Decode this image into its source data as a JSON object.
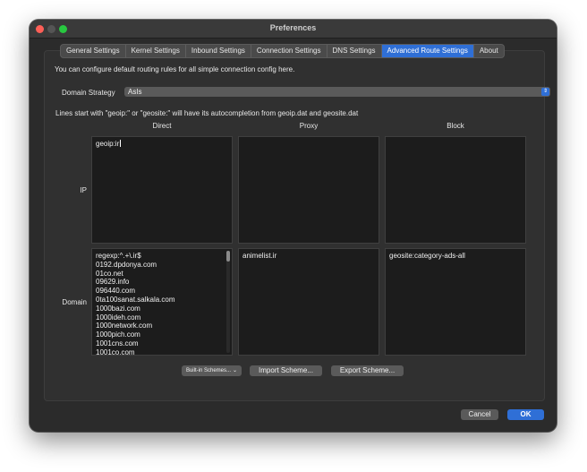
{
  "window": {
    "title": "Preferences"
  },
  "tabs": [
    {
      "label": "General Settings",
      "active": false
    },
    {
      "label": "Kernel Settings",
      "active": false
    },
    {
      "label": "Inbound Settings",
      "active": false
    },
    {
      "label": "Connection Settings",
      "active": false
    },
    {
      "label": "DNS Settings",
      "active": false
    },
    {
      "label": "Advanced Route Settings",
      "active": true
    },
    {
      "label": "About",
      "active": false
    }
  ],
  "routing": {
    "description": "You can configure default routing rules for all simple connection config here.",
    "domain_strategy_label": "Domain Strategy",
    "domain_strategy_value": "AsIs",
    "hint": "Lines start with \"geoip:\" or \"geosite:\" will have its autocompletion from geoip.dat and geosite.dat",
    "columns": {
      "direct": "Direct",
      "proxy": "Proxy",
      "block": "Block"
    },
    "rows": {
      "ip": "IP",
      "domain": "Domain"
    },
    "ip": {
      "direct": [
        "geoip:ir"
      ],
      "proxy": [],
      "block": []
    },
    "domain": {
      "direct": [
        "regexp:^.+\\.ir$",
        "0192.dpdonya.com",
        "01co.net",
        "09629.info",
        "096440.com",
        "0ta100sanat.salkala.com",
        "1000bazi.com",
        "1000ideh.com",
        "1000network.com",
        "1000pich.com",
        "1001cns.com",
        "1001co.com"
      ],
      "proxy": [
        "animelist.ir"
      ],
      "block": [
        "geosite:category-ads-all"
      ]
    }
  },
  "schemes": {
    "builtin_label": "Built-in Schemes...",
    "import_label": "Import Scheme...",
    "export_label": "Export Scheme..."
  },
  "footer": {
    "cancel_label": "Cancel",
    "ok_label": "OK"
  },
  "colors": {
    "accent": "#2f6fd6",
    "window_bg": "#2b2b2b",
    "editor_bg": "#1c1c1c"
  }
}
